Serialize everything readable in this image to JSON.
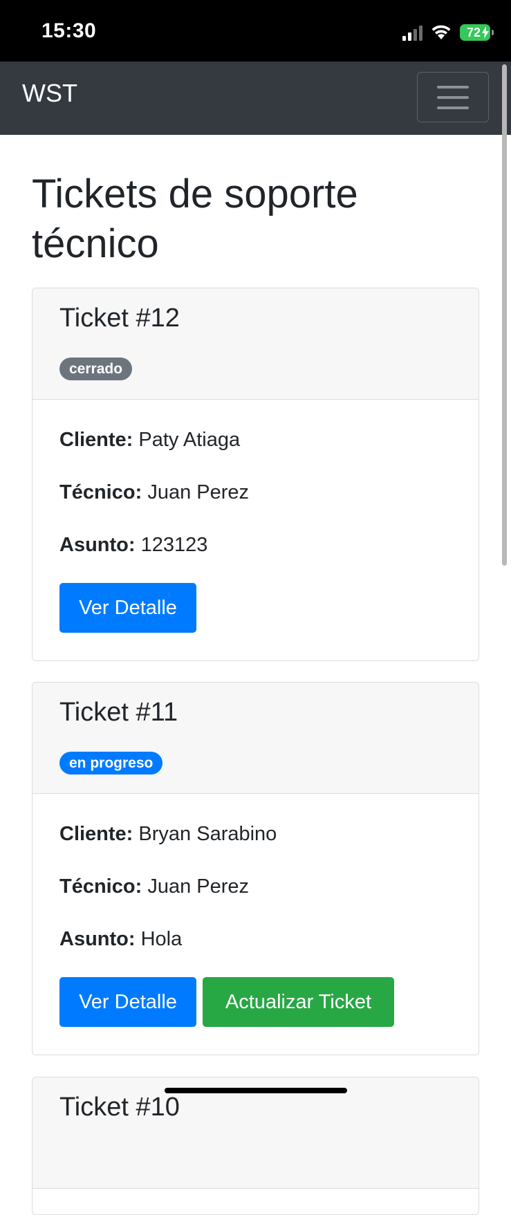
{
  "status_bar": {
    "time": "15:30",
    "battery": "72"
  },
  "navbar": {
    "brand": "WST"
  },
  "page": {
    "title": "Tickets de soporte técnico"
  },
  "labels": {
    "cliente": "Cliente:",
    "tecnico": "Técnico:",
    "asunto": "Asunto:"
  },
  "tickets": [
    {
      "title": "Ticket #12",
      "status": "cerrado",
      "status_color": "#6c757d",
      "cliente": "Paty Atiaga",
      "tecnico": "Juan Perez",
      "asunto": "123123",
      "actions": [
        "Ver Detalle"
      ]
    },
    {
      "title": "Ticket #11",
      "status": "en progreso",
      "status_color": "#007bff",
      "cliente": "Bryan Sarabino",
      "tecnico": "Juan Perez",
      "asunto": "Hola",
      "actions": [
        "Ver Detalle",
        "Actualizar Ticket"
      ]
    },
    {
      "title": "Ticket #10"
    }
  ],
  "colors": {
    "navbar": "#343a40",
    "primary": "#007bff",
    "success": "#28a745",
    "secondary": "#6c757d"
  }
}
